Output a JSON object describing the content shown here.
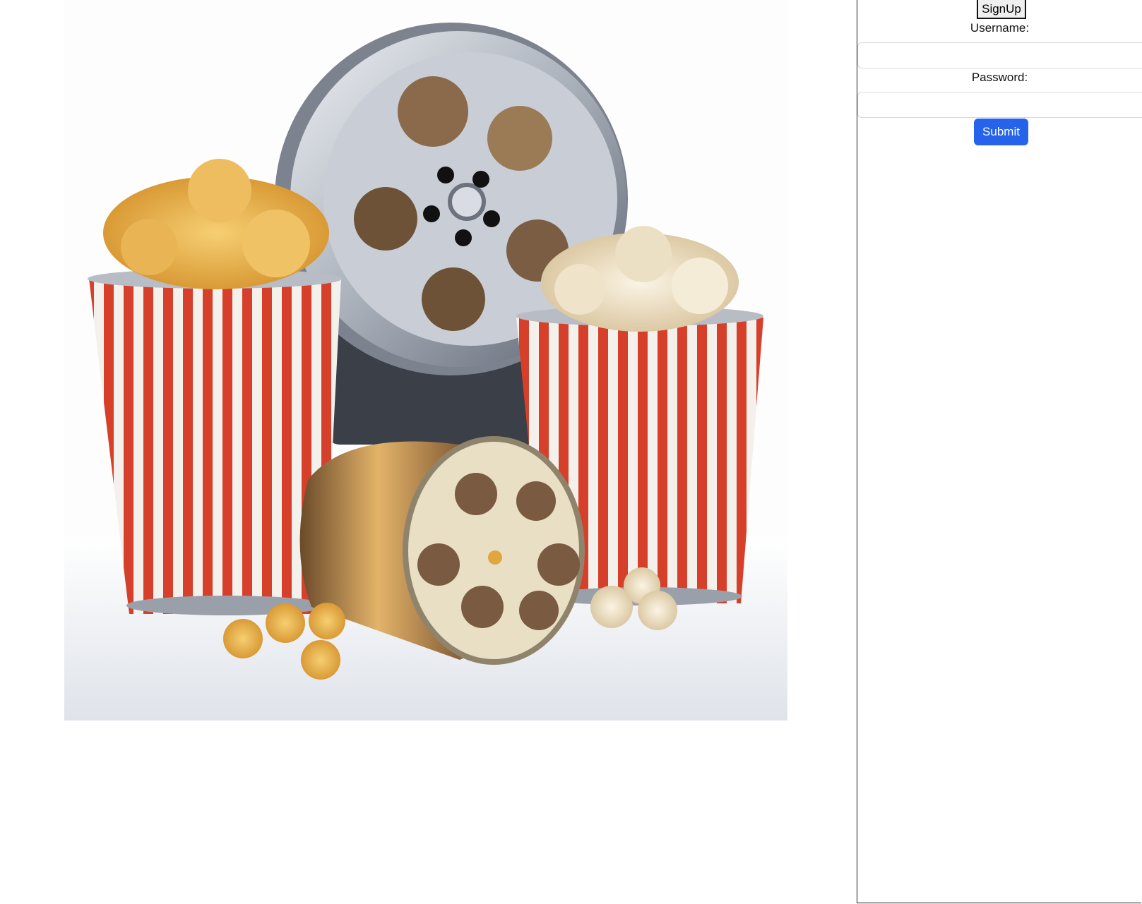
{
  "hero": {
    "icon": "popcorn-film-reel-image"
  },
  "signup_form": {
    "signup_button_label": "SignUp",
    "username_label": "Username:",
    "username_value": "",
    "password_label": "Password:",
    "password_value": "",
    "submit_label": "Submit"
  },
  "colors": {
    "submit_bg": "#2563eb",
    "stripe_red": "#d6402a"
  }
}
